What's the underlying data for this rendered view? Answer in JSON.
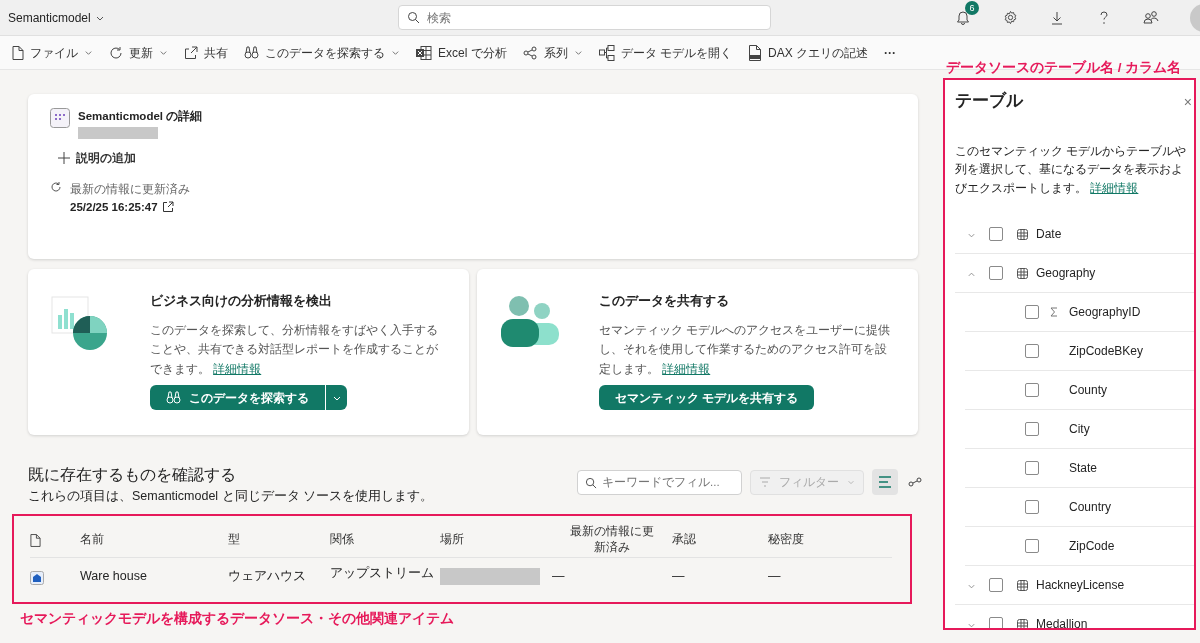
{
  "app": {
    "title": "Semanticmodel"
  },
  "search": {
    "placeholder": "検索"
  },
  "notifications": {
    "count": "6"
  },
  "toolbar": [
    {
      "label": "ファイル",
      "dropdown": true
    },
    {
      "label": "更新",
      "dropdown": true
    },
    {
      "label": "共有",
      "dropdown": false
    },
    {
      "label": "このデータを探索する",
      "dropdown": true
    },
    {
      "label": "Excel で分析",
      "dropdown": false
    },
    {
      "label": "系列",
      "dropdown": true
    },
    {
      "label": "データ モデルを開く",
      "dropdown": false
    },
    {
      "label": "DAX クエリの記述",
      "dropdown": false
    }
  ],
  "more": "···",
  "details_card": {
    "title": "Semanticmodel の詳細",
    "owner_redacted": true,
    "add_description": "説明の追加",
    "refresh_label": "最新の情報に更新済み",
    "refresh_time": "25/2/25 16:25:47"
  },
  "feature_cards": [
    {
      "title": "ビジネス向けの分析情報を検出",
      "body": "このデータを探索して、分析情報をすばやく入手することや、共有できる対話型レポートを作成することができます。",
      "link": "詳細情報",
      "button": "このデータを探索する",
      "split": true
    },
    {
      "title": "このデータを共有する",
      "body": "セマンティック モデルへのアクセスをユーザーに提供し、それを使用して作業するためのアクセス許可を設定します。",
      "link": "詳細情報",
      "button": "セマンティック モデルを共有する",
      "split": false
    }
  ],
  "lineage": {
    "title": "既に存在するものを確認する",
    "subtitle": "これらの項目は、Semanticmodel と同じデータ ソースを使用します。",
    "filter_placeholder": "キーワードでフィル...",
    "filter_button": "フィルター",
    "filter_disabled": true,
    "views": [
      {
        "selected": true
      },
      {
        "selected": false
      }
    ]
  },
  "table": {
    "columns": [
      "名前",
      "型",
      "関係",
      "場所",
      "最新の情報に更新済み",
      "承認",
      "秘密度"
    ],
    "rows": [
      {
        "name": "Ware house",
        "type": "ウェアハウス",
        "relation": "アップストリーム",
        "location_redacted": true,
        "refreshed": "—",
        "endorsement": "—",
        "sensitivity": "—"
      }
    ]
  },
  "annotations": [
    {
      "text": "データソースのテーブル名 / カラム名"
    },
    {
      "text": "セマンティックモデルを構成するデータソース・その他関連アイテム"
    }
  ],
  "tables_panel": {
    "title": "テーブル",
    "close": "×",
    "description": "このセマンティック モデルからテーブルや列を選択して、基になるデータを表示およびエクスポートします。",
    "link": "詳細情報",
    "tables": [
      {
        "name": "Date",
        "expanded": false,
        "checked": false
      },
      {
        "name": "Geography",
        "expanded": true,
        "checked": false,
        "children": [
          {
            "name": "GeographyID",
            "kind": "sum",
            "checked": false
          },
          {
            "name": "ZipCodeBKey",
            "kind": "text",
            "checked": false
          },
          {
            "name": "County",
            "kind": "text",
            "checked": false
          },
          {
            "name": "City",
            "kind": "text",
            "checked": false
          },
          {
            "name": "State",
            "kind": "text",
            "checked": false
          },
          {
            "name": "Country",
            "kind": "text",
            "checked": false
          },
          {
            "name": "ZipCode",
            "kind": "text",
            "checked": false
          }
        ]
      },
      {
        "name": "HackneyLicense",
        "expanded": false,
        "checked": false
      },
      {
        "name": "Medallion",
        "expanded": false,
        "checked": false
      }
    ]
  }
}
